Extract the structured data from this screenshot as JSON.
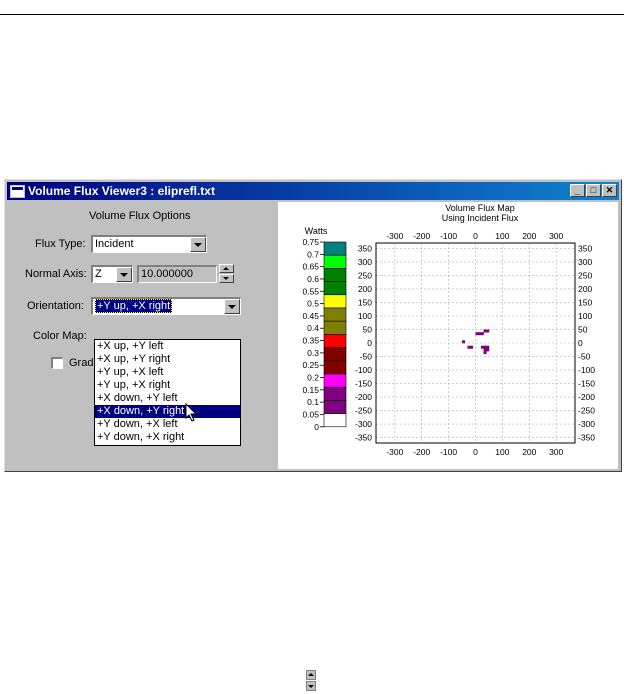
{
  "window": {
    "title": "Volume Flux Viewer3 : eliprefl.txt",
    "controls": {
      "minimize": "_",
      "maximize": "□",
      "close": "✕"
    }
  },
  "options": {
    "heading": "Volume Flux Options",
    "flux_type_label": "Flux Type:",
    "flux_type_value": "Incident",
    "normal_axis_label": "Normal Axis:",
    "normal_axis_value": "Z",
    "normal_axis_number": "10.000000",
    "orientation_label": "Orientation:",
    "orientation_value": "+Y up, +X right",
    "color_map_label": "Color Map:",
    "grad_label": "Grad",
    "orientation_options": [
      "+X up, +Y left",
      "+X up, +Y right",
      "+Y up, +X left",
      "+Y up, +X right",
      "+X down, +Y left",
      "+X down, +Y right",
      "+Y down, +X left",
      "+Y down, +X right"
    ],
    "highlighted_option_index": 5
  },
  "chart_data": {
    "type": "heatmap",
    "title": "Volume Flux Map",
    "subtitle": "Using Incident Flux",
    "colorbar_label": "Watts",
    "colorbar_ticks": [
      "0.75",
      "0.7",
      "0.65",
      "0.6",
      "0.55",
      "0.5",
      "0.45",
      "0.4",
      "0.35",
      "0.3",
      "0.25",
      "0.2",
      "0.15",
      "0.1",
      "0.05",
      "0"
    ],
    "colorbar_colors": [
      "#008080",
      "#00ff00",
      "#008000",
      "#008000",
      "#ffff00",
      "#808000",
      "#808000",
      "#ff0000",
      "#800000",
      "#800000",
      "#ff00ff",
      "#800080",
      "#800080",
      "#ffffff"
    ],
    "xlim": [
      -370,
      370
    ],
    "ylim": [
      -370,
      370
    ],
    "x_ticks": [
      -300,
      -200,
      -100,
      0,
      100,
      200,
      300
    ],
    "y_ticks": [
      350,
      300,
      250,
      200,
      150,
      100,
      50,
      0,
      -50,
      -100,
      -150,
      -200,
      -250,
      -300,
      -350
    ],
    "grid": true,
    "hot_cells": [
      {
        "x": 0,
        "y": 40
      },
      {
        "x": 10,
        "y": 40
      },
      {
        "x": 20,
        "y": 40
      },
      {
        "x": 30,
        "y": 50
      },
      {
        "x": 40,
        "y": 50
      },
      {
        "x": -50,
        "y": 10
      },
      {
        "x": -30,
        "y": -10
      },
      {
        "x": -20,
        "y": -10
      },
      {
        "x": 20,
        "y": -10
      },
      {
        "x": 30,
        "y": -10
      },
      {
        "x": 40,
        "y": -10
      },
      {
        "x": 30,
        "y": -20
      },
      {
        "x": 40,
        "y": -20
      },
      {
        "x": 30,
        "y": -30
      }
    ],
    "hot_color": "#800080"
  }
}
